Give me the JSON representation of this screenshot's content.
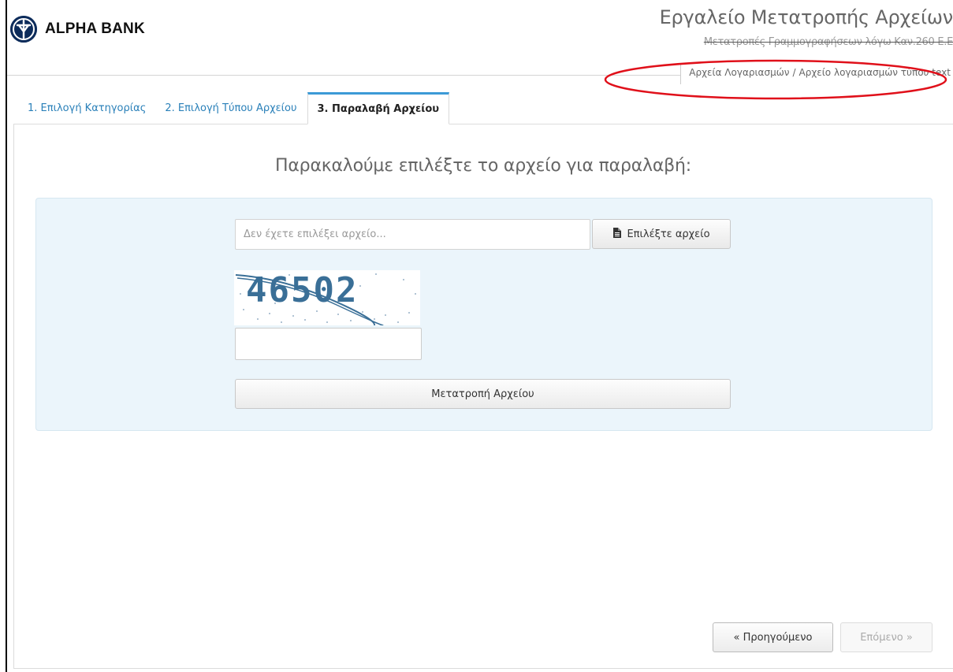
{
  "header": {
    "brand": "ALPHA BANK",
    "app_title": "Εργαλείο Μετατροπής Αρχείων",
    "app_subtitle": "Μετατροπές Γραμμογραφήσεων λόγω Καν.260 Ε.Ε",
    "breadcrumb": {
      "first": "Αρχεία Λογαριασμών",
      "separator": "/",
      "second": "Αρχείο λογαριασμών τύπου text"
    }
  },
  "tabs": [
    {
      "label": "1. Επιλογή Κατηγορίας",
      "active": false
    },
    {
      "label": "2. Επιλογή Τύπου Αρχείου",
      "active": false
    },
    {
      "label": "3. Παραλαβή Αρχείου",
      "active": true
    }
  ],
  "main": {
    "prompt": "Παρακαλούμε επιλέξτε το αρχείο για παραλαβή:",
    "file_input": {
      "placeholder": "Δεν έχετε επιλέξει αρχείο...",
      "value": ""
    },
    "browse_label": "Επιλέξτε αρχείο",
    "captcha_text": "46502",
    "captcha_input": {
      "value": ""
    },
    "convert_label": "Μετατροπή Αρχείου"
  },
  "footer": {
    "prev_label": "« Προηγούμενο",
    "next_label": "Επόμενο »"
  },
  "colors": {
    "brand_navy": "#0d2c5b",
    "tab_link": "#2a80b9",
    "active_tab_border": "#3c9ad6",
    "well_background": "#ebf5fb",
    "annotation": "#e0101a"
  }
}
